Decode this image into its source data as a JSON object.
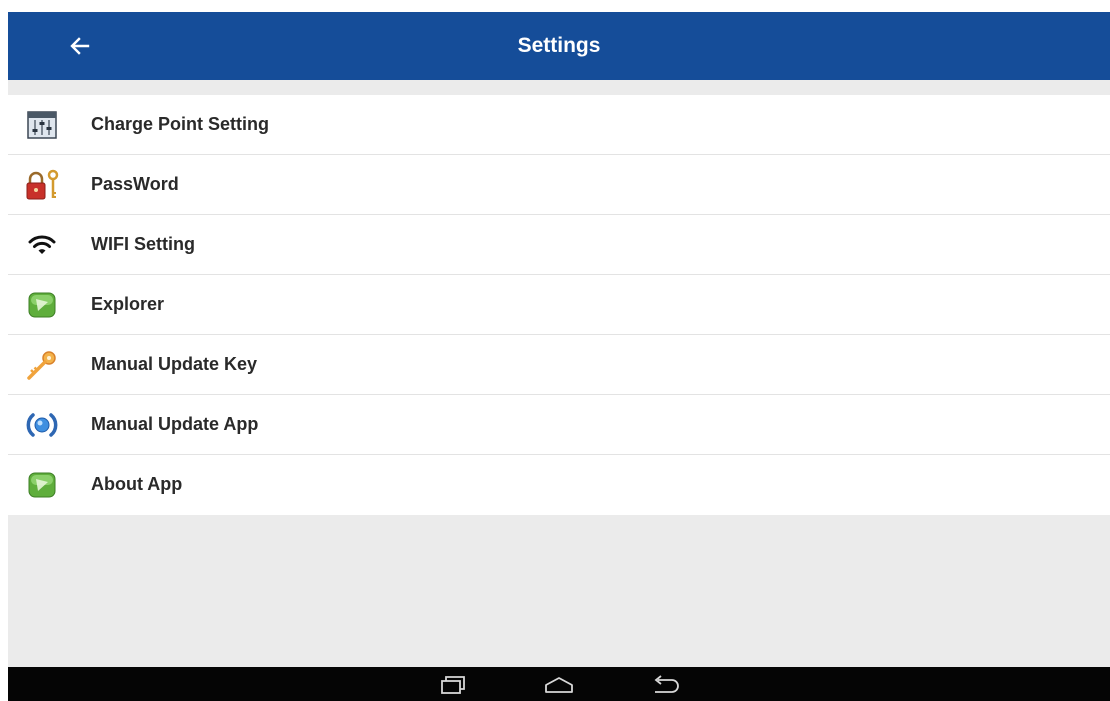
{
  "appbar": {
    "title": "Settings",
    "back_icon": "arrow-left-icon"
  },
  "colors": {
    "appbar": "#154d99",
    "background": "#ebebeb",
    "list_background": "#ffffff",
    "navbar": "#050505"
  },
  "menu": {
    "items": [
      {
        "label": "Charge Point Setting",
        "icon": "sliders-icon"
      },
      {
        "label": "PassWord",
        "icon": "lock-key-icon"
      },
      {
        "label": "WIFI Setting",
        "icon": "wifi-icon"
      },
      {
        "label": "Explorer",
        "icon": "green-app-icon"
      },
      {
        "label": "Manual Update Key",
        "icon": "key-icon"
      },
      {
        "label": "Manual Update App",
        "icon": "update-app-icon"
      },
      {
        "label": "About App",
        "icon": "green-app-icon"
      }
    ]
  },
  "navbar": {
    "buttons": [
      "recent-apps-icon",
      "home-icon",
      "back-icon"
    ]
  }
}
